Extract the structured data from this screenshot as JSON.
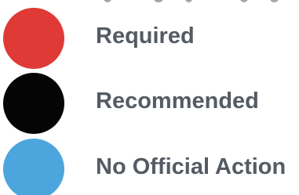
{
  "legend": {
    "items": [
      {
        "label": "Required",
        "color": "#e03a37"
      },
      {
        "label": "Recommended",
        "color": "#050505"
      },
      {
        "label": "No Official Action",
        "color": "#4ca6dd"
      }
    ],
    "text_color": "#545b63"
  }
}
